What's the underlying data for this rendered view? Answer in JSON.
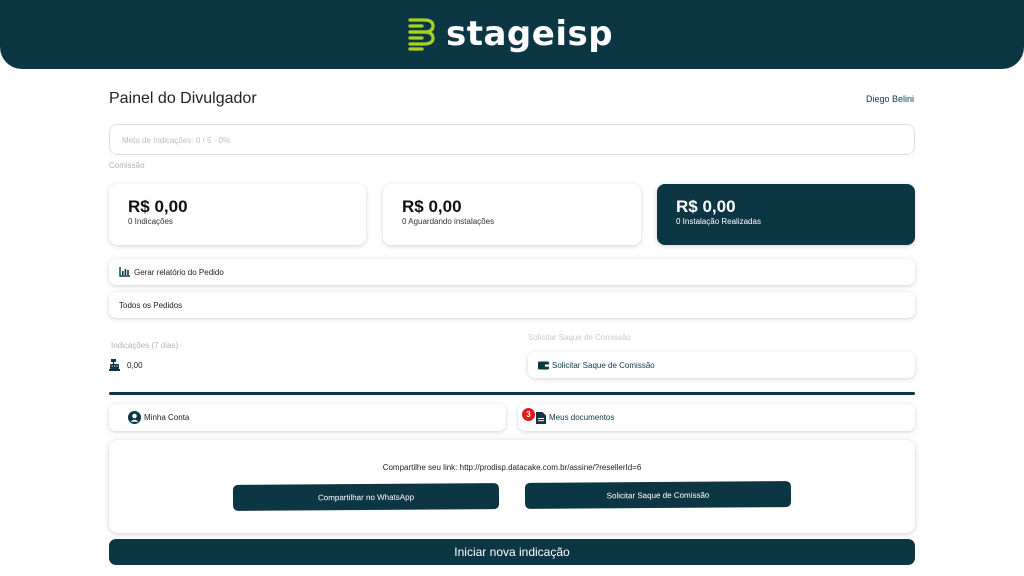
{
  "header": {
    "brand": "stageisp",
    "accent_color": "#a6d41e",
    "bg_color": "#0c3644"
  },
  "page": {
    "title": "Painel do Divulgador",
    "user": "Diego Belini"
  },
  "goal": {
    "text": "Meta de Indicações: 0 / 5 · 0%"
  },
  "commission": {
    "label": "Comissão",
    "cards": [
      {
        "amount": "R$ 0,00",
        "subtitle": "0 Indicações"
      },
      {
        "amount": "R$ 0,00",
        "subtitle": "0 Aguardando instalações"
      },
      {
        "amount": "R$ 0,00",
        "subtitle": "0 Instalação Realizadas"
      }
    ]
  },
  "actions": {
    "report": "Gerar relatório do Pedido",
    "all_orders": "Todos os Pedidos"
  },
  "indicacoes": {
    "label": "Indicações (7 dias)",
    "value": "0,00"
  },
  "saque": {
    "label": "Solicitar Saque de Comissão",
    "button": "Solicitar Saque de Comissão"
  },
  "account": {
    "my_account": "Minha Conta",
    "documents": "Meus documentos",
    "documents_badge": "3"
  },
  "share": {
    "link_text": "Compartilhe seu link: http://prodisp.datacake.com.br/assine/?resellerId=6",
    "whatsapp": "Compartilhar no WhatsApp",
    "saque": "Solicitar Saque de Comissão"
  },
  "start": {
    "label": "Iniciar nova indicação"
  },
  "icons": [
    "logo-icon",
    "chart-icon",
    "cash-register-icon",
    "wallet-icon",
    "user-circle-icon",
    "document-icon"
  ]
}
